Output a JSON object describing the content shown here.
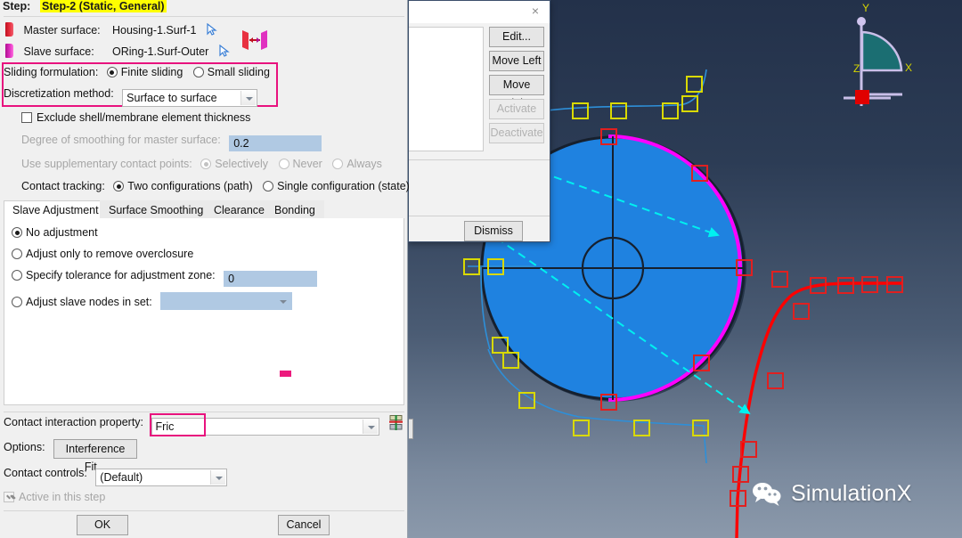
{
  "step": {
    "label": "Step:",
    "value": "Step-2 (Static, General)"
  },
  "surfaces": {
    "master_label": "Master surface:",
    "master_value": "Housing-1.Surf-1",
    "slave_label": "Slave surface:",
    "slave_value": "ORing-1.Surf-Outer"
  },
  "sliding": {
    "label": "Sliding formulation:",
    "option_finite": "Finite sliding",
    "option_small": "Small sliding",
    "selected": "Finite sliding"
  },
  "discretization": {
    "label": "Discretization method:",
    "value": "Surface to surface"
  },
  "exclude_shell": {
    "label": "Exclude shell/membrane element thickness",
    "checked": false
  },
  "smoothing": {
    "label": "Degree of smoothing for master surface:",
    "value": "0.2",
    "enabled": false
  },
  "supplementary": {
    "label": "Use supplementary contact points:",
    "option_selectively": "Selectively",
    "option_never": "Never",
    "option_always": "Always",
    "selected": "Selectively",
    "enabled": false
  },
  "tracking": {
    "label": "Contact tracking:",
    "option_two": "Two configurations (path)",
    "option_single": "Single configuration (state)",
    "selected": "Two configurations (path)"
  },
  "tabs": [
    {
      "label": "Slave Adjustment",
      "active": true
    },
    {
      "label": "Surface Smoothing",
      "active": false
    },
    {
      "label": "Clearance",
      "active": false
    },
    {
      "label": "Bonding",
      "active": false
    }
  ],
  "slave_adjustment": {
    "no_adjustment": "No adjustment",
    "remove_overclosure": "Adjust only to remove overclosure",
    "specify_tolerance": "Specify tolerance for adjustment zone:",
    "tolerance_value": "0",
    "adjust_nodes_in_set": "Adjust slave nodes in set:",
    "node_set_value": "",
    "selected": "No adjustment"
  },
  "footer": {
    "interaction_property_label": "Contact interaction property:",
    "interaction_property_value": "Fric",
    "options_label": "Options:",
    "options_button": "Interference Fit...",
    "contact_controls_label": "Contact controls:",
    "contact_controls_value": "(Default)",
    "active_in_step_label": "Active in this step",
    "active_in_step_checked": true,
    "ok": "OK",
    "cancel": "Cancel"
  },
  "back_dialog": {
    "close": "×",
    "buttons": [
      {
        "label": "Edit...",
        "enabled": true
      },
      {
        "label": "Move Left",
        "enabled": true
      },
      {
        "label": "Move Right",
        "enabled": true
      },
      {
        "label": "Activate",
        "enabled": false
      },
      {
        "label": "Deactivate",
        "enabled": false
      }
    ],
    "dismiss": "Dismiss"
  },
  "viewport": {
    "triad": {
      "x": "X",
      "y": "Y",
      "z": "Z"
    },
    "watermark": "SimulationX"
  },
  "colors": {
    "highlight_pink": "#e8127e",
    "step_highlight": "#ffff00",
    "master_surface": "#e83040",
    "slave_surface": "#e030c0",
    "part_fill": "#1f82e0",
    "oring_edge": "#ff00ff",
    "node_yellow": "#d9d900",
    "node_red": "#e02020",
    "annotation_cyan": "#00f0f0",
    "disabled_field": "#b0c9e3"
  }
}
